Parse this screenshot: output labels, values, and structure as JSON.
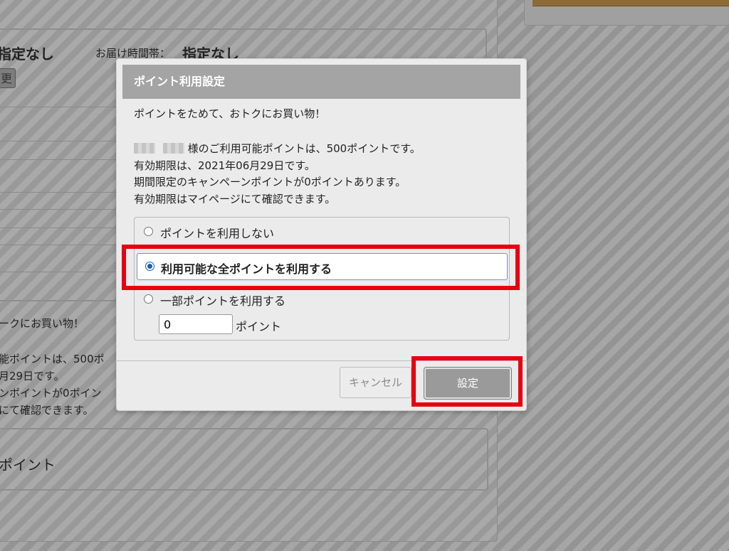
{
  "background": {
    "delivery_date_value": "指定なし",
    "delivery_time_label": "お届け時間帯：",
    "delivery_time_value": "指定なし",
    "change_button_glyph": "更",
    "promo_text_partial": "ークにお買い物！",
    "available_points_partial": "能ポイントは、500ポ",
    "expiry_partial": "月29日です。",
    "campaign_partial": "ンポイントが0ポイン",
    "confirm_partial": "にて確認できます。",
    "points_section_partial": "ポイント"
  },
  "modal": {
    "title": "ポイント利用設定",
    "intro": "ポイントをためて、おトクにお買い物！",
    "user_points_text": "様のご利用可能ポイントは、500ポイントです。",
    "expiry_text": "有効期限は、2021年06月29日です。",
    "campaign_text": "期間限定のキャンペーンポイントが0ポイントあります。",
    "mypage_text": "有効期限はマイページにて確認できます。",
    "options": [
      {
        "label": "ポイントを利用しない",
        "checked": false
      },
      {
        "label": "利用可能な全ポイントを利用する",
        "checked": true
      },
      {
        "label": "一部ポイントを利用する",
        "checked": false
      }
    ],
    "partial_points_value": "0",
    "partial_points_unit": "ポイント",
    "cancel_label": "キャンセル",
    "set_label": "設定"
  },
  "colors": {
    "highlight": "#e60012",
    "radio_selected": "#1a5fb4",
    "header_bg": "#a4a4a4"
  }
}
